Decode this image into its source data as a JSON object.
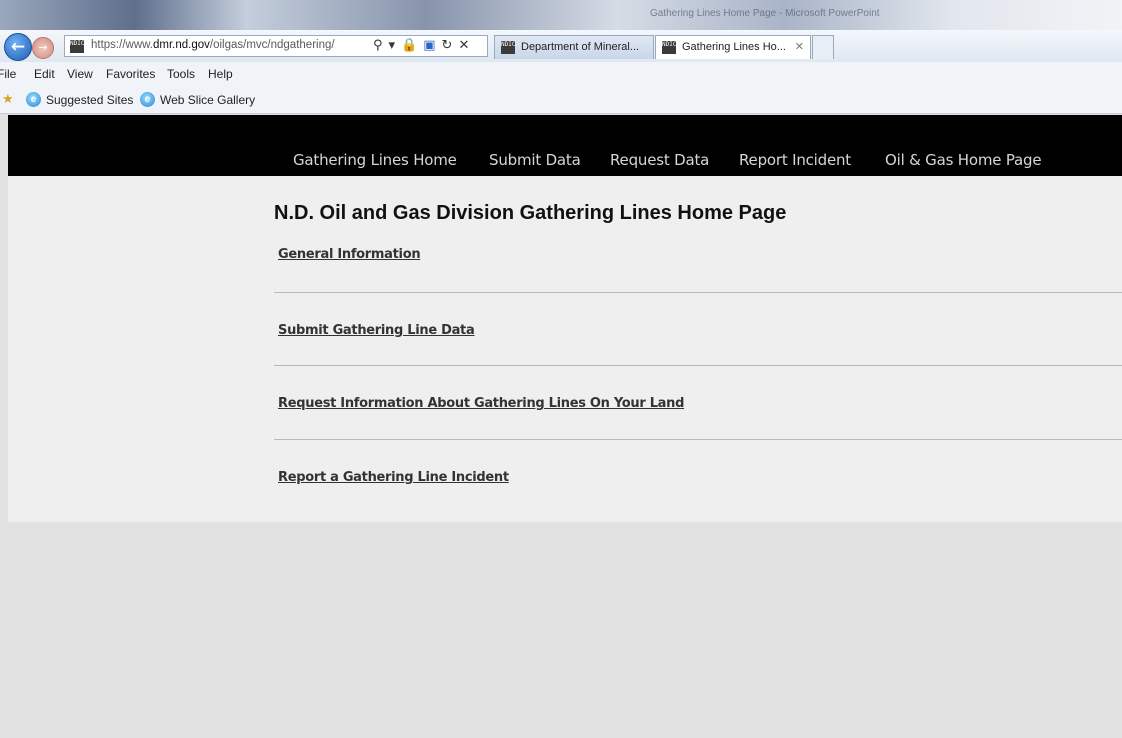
{
  "browser": {
    "title": "Gathering Lines Home Page - Microsoft PowerPoint",
    "url_prefix": "https://www.",
    "url_domain": "dmr.nd.gov",
    "url_path": "/oilgas/mvc/ndgathering/",
    "tabs": [
      {
        "label": "Department of Mineral..."
      },
      {
        "label": "Gathering Lines Ho..."
      }
    ],
    "favicon_text": "NDIC",
    "menu": [
      "File",
      "Edit",
      "View",
      "Favorites",
      "Tools",
      "Help"
    ],
    "favorites": [
      "Suggested Sites",
      "Web Slice Gallery"
    ]
  },
  "site": {
    "nav": [
      "Gathering Lines Home",
      "Submit Data",
      "Request Data",
      "Report Incident",
      "Oil & Gas Home Page"
    ],
    "title": "N.D. Oil and Gas Division Gathering Lines Home Page",
    "sections": [
      "General Information",
      "Submit Gathering Line Data",
      "Request Information About Gathering Lines On Your Land",
      "Report a Gathering Line Incident"
    ]
  },
  "colors": {
    "header_bg": "#000000",
    "nav_text": "#d6d6d6",
    "content_bg": "#efefef",
    "page_bg": "#e2e2e2"
  },
  "icons": [
    "back-arrow-icon",
    "forward-arrow-icon",
    "search-icon",
    "lock-icon",
    "refresh-icon",
    "stop-icon",
    "favorites-star-icon",
    "ie-icon"
  ]
}
